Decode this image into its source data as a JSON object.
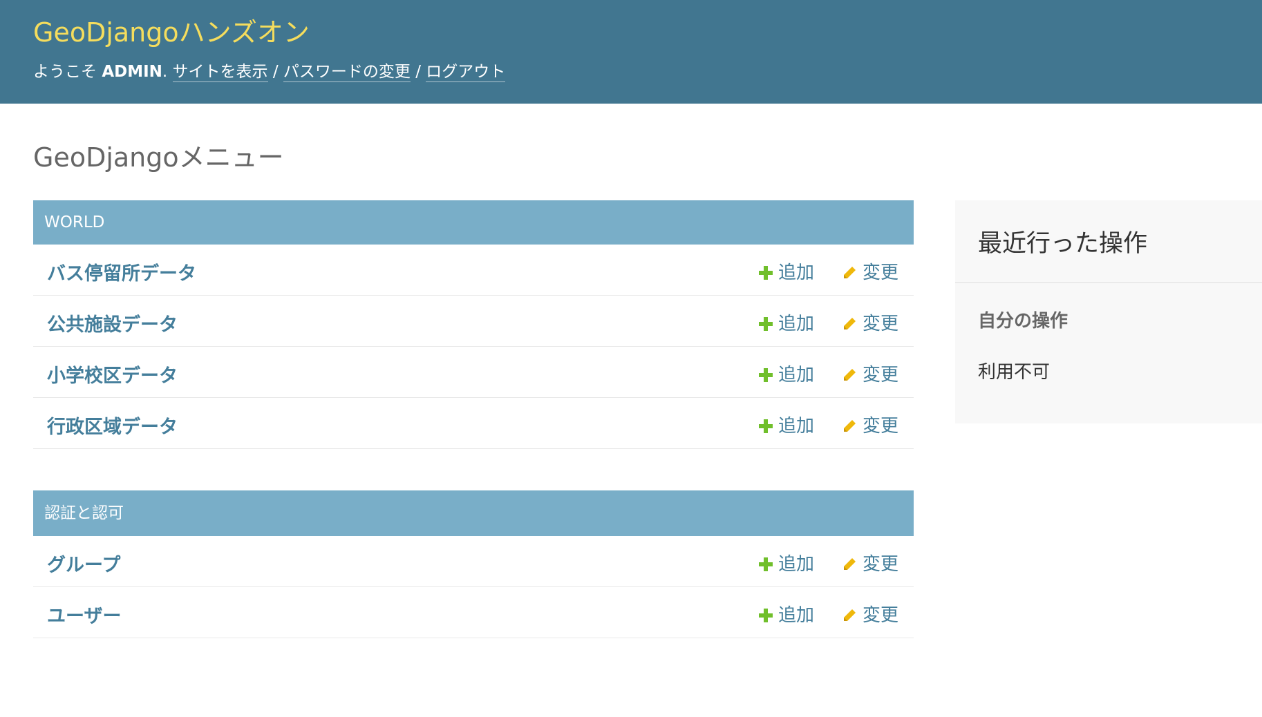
{
  "header": {
    "site_title": "GeoDjangoハンズオン",
    "welcome_prefix": "ようこそ ",
    "username": "ADMIN",
    "welcome_suffix": ". ",
    "view_site": "サイトを表示",
    "separator": " / ",
    "change_password": "パスワードの変更",
    "logout": "ログアウト"
  },
  "page_title": "GeoDjangoメニュー",
  "modules": [
    {
      "caption": "WORLD",
      "rows": [
        {
          "name": "バス停留所データ",
          "add_label": "追加",
          "change_label": "変更"
        },
        {
          "name": "公共施設データ",
          "add_label": "追加",
          "change_label": "変更"
        },
        {
          "name": "小学校区データ",
          "add_label": "追加",
          "change_label": "変更"
        },
        {
          "name": "行政区域データ",
          "add_label": "追加",
          "change_label": "変更"
        }
      ]
    },
    {
      "caption": "認証と認可",
      "rows": [
        {
          "name": "グループ",
          "add_label": "追加",
          "change_label": "変更"
        },
        {
          "name": "ユーザー",
          "add_label": "追加",
          "change_label": "変更"
        }
      ]
    }
  ],
  "recent_actions": {
    "title": "最近行った操作",
    "my_actions": "自分の操作",
    "empty_text": "利用不可"
  },
  "icons": {
    "add": "plus-icon",
    "change": "pencil-icon"
  },
  "colors": {
    "header_bg": "#417690",
    "site_title": "#f5dd5d",
    "caption_bg": "#79aec8",
    "link": "#447e9b",
    "add_icon": "#70bf2b",
    "change_icon": "#efb80b",
    "sidebar_bg": "#f8f8f8"
  }
}
